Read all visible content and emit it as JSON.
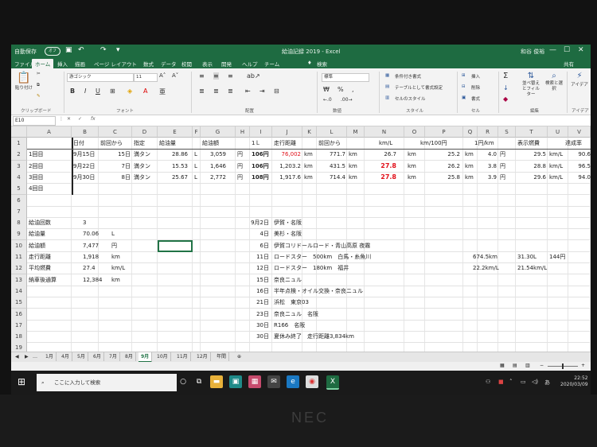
{
  "titlebar": {
    "autosave_label": "自動保存",
    "autosave_state": "オフ",
    "document_title": "給油記録 2019 - Excel",
    "user_name": "和谷 俊裕"
  },
  "tabs": [
    "ファイル",
    "ホーム",
    "挿入",
    "描画",
    "ページ レイアウト",
    "数式",
    "データ",
    "校閲",
    "表示",
    "開発",
    "ヘルプ",
    "チーム"
  ],
  "search_hint": "検索",
  "share_label": "共有",
  "ribbon": {
    "paste_label": "貼り付け",
    "clipboard_group": "クリップボード",
    "font_name": "游ゴシック",
    "font_size": "11",
    "font_group": "フォント",
    "align_group": "配置",
    "number_format": "標準",
    "number_group": "数値",
    "cond_format": "条件付き書式",
    "table_format": "テーブルとして書式設定",
    "cell_style": "セルのスタイル",
    "style_group": "スタイル",
    "insert_label": "挿入",
    "delete_label": "削除",
    "format_label": "書式",
    "cell_group": "セル",
    "sort_filter": "並べ替えとフィルター",
    "find_select": "検索と選択",
    "edit_group": "編集",
    "ideas_label": "アイデア",
    "ideas_group": "アイデア"
  },
  "formula_bar": {
    "name_box": "E10",
    "formula": ""
  },
  "columns": [
    "A",
    "B",
    "C",
    "D",
    "E",
    "F",
    "G",
    "H",
    "I",
    "J",
    "K",
    "L",
    "M",
    "N",
    "O",
    "P",
    "Q",
    "R",
    "S",
    "T",
    "U",
    "V"
  ],
  "rows": [
    "1",
    "2",
    "3",
    "4",
    "5",
    "6",
    "7",
    "8",
    "9",
    "10",
    "11",
    "12",
    "13",
    "14",
    "15",
    "16",
    "17",
    "18",
    "19"
  ],
  "header_row": {
    "date": "日付",
    "from_last": "前回から",
    "spec": "指定",
    "fuel_amount": "給油量",
    "fuel_cost": "給油額",
    "per_liter": "1Ｌ",
    "distance": "走行距離",
    "from_last2": "前回から",
    "km_per_l": "km/L",
    "km_per_100yen": "km/100円",
    "yen_per_km": "1円/km",
    "shown_mileage": "表示燃費",
    "achievement": "達成率"
  },
  "fill_rows": [
    {
      "label": "1回目",
      "date": "9月15日",
      "days": "15日",
      "spec": "満タン",
      "amount": "28.86",
      "amount_unit": "L",
      "cost": "3,059",
      "cost_unit": "円",
      "per_l": "106円",
      "odo": "76,002",
      "odo_unit": "km",
      "delta": "771.7",
      "delta_unit": "km",
      "kml": "26.7",
      "kml_unit": "km",
      "k100": "25.2",
      "k100_unit": "km",
      "ypk": "4.0",
      "ypk_unit": "円",
      "disp": "29.5",
      "disp_unit": "km/L",
      "ach": "90.6"
    },
    {
      "label": "2回目",
      "date": "9月22日",
      "days": "7日",
      "spec": "満タン",
      "amount": "15.53",
      "amount_unit": "L",
      "cost": "1,646",
      "cost_unit": "円",
      "per_l": "106円",
      "odo": "1,203.2",
      "odo_unit": "km",
      "delta": "431.5",
      "delta_unit": "km",
      "kml": "27.8",
      "kml_unit": "km",
      "k100": "26.2",
      "k100_unit": "km",
      "ypk": "3.8",
      "ypk_unit": "円",
      "disp": "28.8",
      "disp_unit": "km/L",
      "ach": "96.5"
    },
    {
      "label": "3回目",
      "date": "9月30日",
      "days": "8日",
      "spec": "満タン",
      "amount": "25.67",
      "amount_unit": "L",
      "cost": "2,772",
      "cost_unit": "円",
      "per_l": "108円",
      "odo": "1,917.6",
      "odo_unit": "km",
      "delta": "714.4",
      "delta_unit": "km",
      "kml": "27.8",
      "kml_unit": "km",
      "k100": "25.8",
      "k100_unit": "km",
      "ypk": "3.9",
      "ypk_unit": "円",
      "disp": "29.6",
      "disp_unit": "km/L",
      "ach": "94.0"
    },
    {
      "label": "4回目"
    }
  ],
  "summary": [
    {
      "label": "給油回数",
      "value": "3",
      "unit": ""
    },
    {
      "label": "給油量",
      "value": "70.06",
      "unit": "L"
    },
    {
      "label": "給油額",
      "value": "7,477",
      "unit": "円"
    },
    {
      "label": "走行距離",
      "value": "1,918",
      "unit": "km"
    },
    {
      "label": "平均燃費",
      "value": "27.4",
      "unit": "km/L"
    },
    {
      "label": "納車後通算",
      "value": "12,384",
      "unit": "km"
    }
  ],
  "log": [
    {
      "date": "9月2日",
      "text": "伊賀・名阪"
    },
    {
      "date": "4日",
      "text": "美杉・名阪"
    },
    {
      "date": "6日",
      "text": "伊賀コリドールロード・青山高原 夜霧"
    },
    {
      "date": "11日",
      "text": "ロードスター　500km　白馬・糸魚川"
    },
    {
      "date": "12日",
      "text": "ロードスター　180km　福井"
    },
    {
      "date": "15日",
      "text": "奈良ニュル"
    },
    {
      "date": "16日",
      "text": "半年点検・オイル交換・奈良ニュル"
    },
    {
      "date": "21日",
      "text": "浜松　東京03"
    },
    {
      "date": "23日",
      "text": "奈良ニュル　名阪"
    },
    {
      "date": "30日",
      "text": "R166　名阪"
    },
    {
      "date": "30日",
      "text": "夏休み終了　走行距離3,834km"
    }
  ],
  "side_notes": {
    "r11_km": "674.5km",
    "r11_l": "31.30L",
    "r11_yen": "144円",
    "r12_kml": "22.2km/L",
    "r12_kml2": "21.54km/L"
  },
  "sheet_tabs": [
    "1月",
    "4月",
    "5月",
    "6月",
    "7月",
    "8月",
    "9月",
    "10月",
    "11月",
    "12月",
    "年間"
  ],
  "active_sheet": "9月",
  "taskbar": {
    "search_placeholder": "ここに入力して検索",
    "time": "22:52",
    "date": "2020/03/09"
  },
  "bezel_brand": "NEC",
  "colors": {
    "excel_green": "#1e6b41",
    "red": "#e1111a"
  }
}
